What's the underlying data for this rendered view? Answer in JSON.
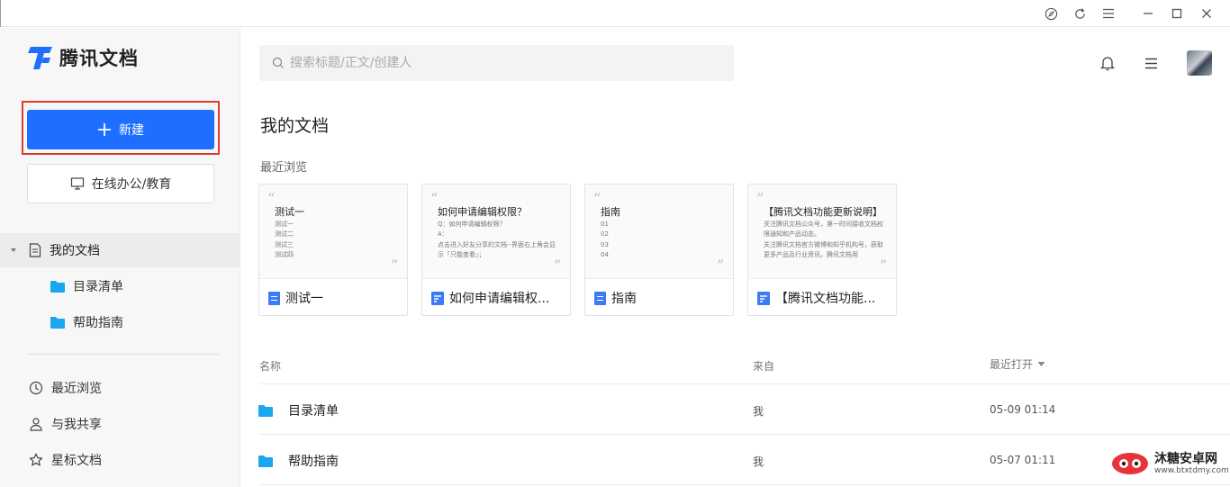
{
  "window": {
    "controls": [
      "compass-icon",
      "refresh-icon",
      "menu-icon",
      "minimize-icon",
      "maximize-icon",
      "close-icon"
    ]
  },
  "app": {
    "name": "腾讯文档",
    "brand_color": "#1e6fff"
  },
  "sidebar": {
    "new_label": "新建",
    "edu_label": "在线办公/教育",
    "my_docs": "我的文档",
    "folders": [
      {
        "label": "目录清单"
      },
      {
        "label": "帮助指南"
      }
    ],
    "nav": [
      {
        "label": "最近浏览",
        "icon": "clock-icon"
      },
      {
        "label": "与我共享",
        "icon": "user-icon"
      },
      {
        "label": "星标文档",
        "icon": "star-icon"
      }
    ]
  },
  "search": {
    "placeholder": "搜索标题/正文/创建人",
    "value": ""
  },
  "main": {
    "title": "我的文档",
    "recent_label": "最近浏览",
    "cards": [
      {
        "heading": "测试一",
        "lines": [
          "测试一",
          "测试二",
          "测试三",
          "测试四"
        ],
        "title": "测试一",
        "type": "doc"
      },
      {
        "heading": "如何申请编辑权限？",
        "lines": [
          "Q：如何申请编辑权限？",
          "A：",
          "点击进入好友分享的文档--界面右上角会显示「只能查看」；"
        ],
        "title": "如何申请编辑权...",
        "type": "form"
      },
      {
        "heading": "指南",
        "lines": [
          "01",
          "02",
          "03",
          "04"
        ],
        "title": "指南",
        "type": "doc"
      },
      {
        "heading": "【腾讯文档功能更新说明】",
        "lines": [
          "关注腾讯文档公众号，第一时间接收文档权限通知和产品动态。",
          "关注腾讯文档官方微博和知乎机构号，获取更多产品及行业资讯。腾讯文档用"
        ],
        "title": "【腾讯文档功能...",
        "type": "form"
      }
    ],
    "table": {
      "headers": {
        "name": "名称",
        "from": "来自",
        "opened": "最近打开"
      },
      "rows": [
        {
          "name": "目录清单",
          "from": "我",
          "opened": "05-09 01:14"
        },
        {
          "name": "帮助指南",
          "from": "我",
          "opened": "05-07 01:11"
        }
      ]
    }
  },
  "watermark": {
    "line1": "沐糖安卓网",
    "line2": "www.btxtdmy.com"
  }
}
